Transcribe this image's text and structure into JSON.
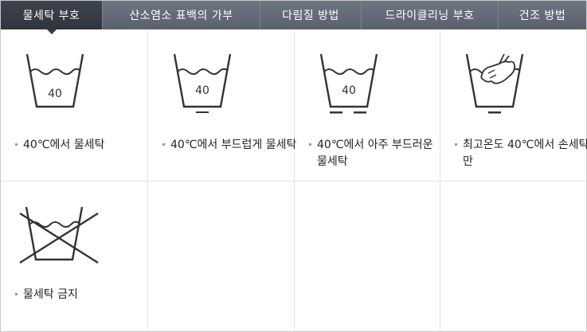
{
  "tabs": [
    {
      "label": "물세탁 부호",
      "active": true
    },
    {
      "label": "산소염소 표백의 가부",
      "active": false
    },
    {
      "label": "다림질 방법",
      "active": false
    },
    {
      "label": "드라이클리닝 부호",
      "active": false
    },
    {
      "label": "건조 방법",
      "active": false
    }
  ],
  "symbols": [
    {
      "icon": "wash-tub-40-icon",
      "temperature": "40",
      "caption": "40℃에서 물세탁"
    },
    {
      "icon": "wash-tub-40-gentle-icon",
      "temperature": "40",
      "caption": "40℃에서 부드럽게 물세탁"
    },
    {
      "icon": "wash-tub-40-very-gentle-icon",
      "temperature": "40",
      "caption": "40℃에서 아주 부드러운 물세탁"
    },
    {
      "icon": "hand-wash-icon",
      "caption": "최고온도 40℃에서 손세탁만"
    },
    {
      "icon": "do-not-wash-icon",
      "caption": "물세탁 금지"
    }
  ],
  "colors": {
    "tab_bg": "#5f6571",
    "tab_active": "#343a44",
    "icon_stroke": "#333333"
  }
}
